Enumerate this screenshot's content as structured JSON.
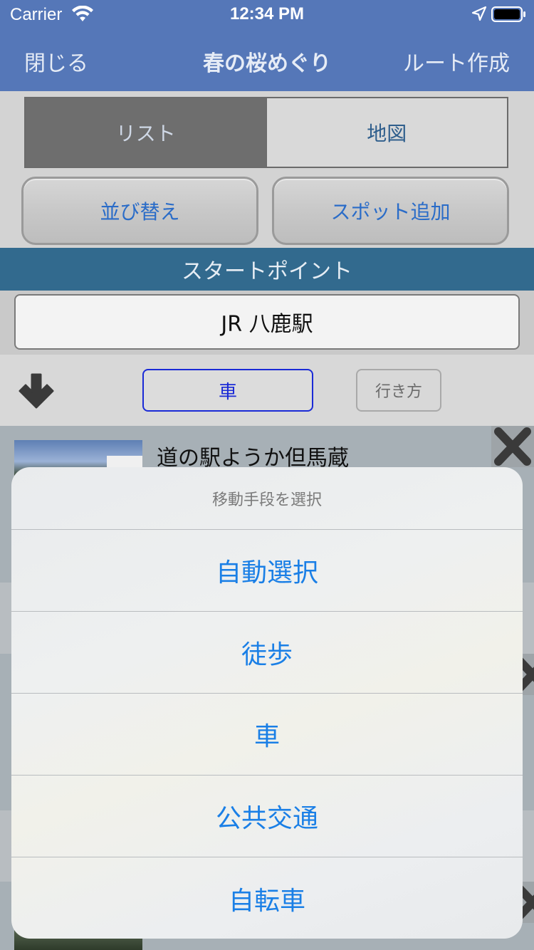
{
  "status": {
    "carrier": "Carrier",
    "time": "12:34 PM"
  },
  "nav": {
    "close": "閉じる",
    "title": "春の桜めぐり",
    "create_route": "ルート作成"
  },
  "segments": {
    "list": "リスト",
    "map": "地図"
  },
  "buttons": {
    "sort": "並び替え",
    "add_spot": "スポット追加"
  },
  "section": {
    "start_point": "スタートポイント"
  },
  "start": {
    "name": "JR 八鹿駅"
  },
  "transport": {
    "mode": "車",
    "directions": "行き方"
  },
  "spots": [
    {
      "name": "道の駅ようか但馬蔵"
    }
  ],
  "action_sheet": {
    "title": "移動手段を選択",
    "options": [
      "自動選択",
      "徒歩",
      "車",
      "公共交通",
      "自転車"
    ]
  },
  "colors": {
    "nav_bar": "#5577b8",
    "section_header": "#326a8e",
    "action_blue": "#1a7fe6"
  }
}
